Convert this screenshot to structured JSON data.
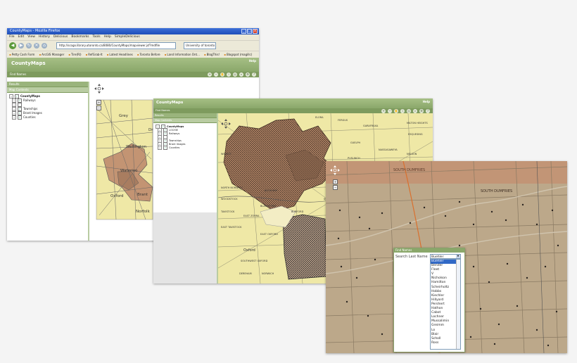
{
  "shot1": {
    "window_title": "CountyMaps - Mozilla Firefox",
    "window_buttons": [
      "_",
      "□",
      "x"
    ],
    "menu": [
      "File",
      "Edit",
      "View",
      "History",
      "Delicious",
      "Bookmarks",
      "Tools",
      "Help",
      "SimpleDelicious"
    ],
    "nav_icons": [
      "back-icon",
      "forward-icon",
      "reload-icon",
      "stop-icon",
      "home-icon"
    ],
    "nav_glyphs": {
      "back": "◀",
      "forward": "▶",
      "reload": "↻",
      "stop": "✕",
      "home": "⌂"
    },
    "url": "http://scogo.library.utoronto.ca/8080/CountyMaps/mapviewer.jsf?mdfile",
    "search_placeholder": "University of toronto",
    "bookmarks": [
      "Petty Cash Form",
      "ArcGIS Manager",
      "Tire(RI)",
      "RefGrab-It",
      "Latest Headlines",
      "Toronto Before",
      "Land Information Ont...",
      "BlogThis!",
      "Blogspot (magillc)"
    ],
    "app_title": "CountyMaps",
    "help": "Help",
    "find_names": "Find Names",
    "results": "Results",
    "map_contents": "Map Contents",
    "tree": {
      "root": "CountyMaps",
      "items": [
        "Railways",
        "",
        "Townships",
        "Brant Images",
        "Counties"
      ]
    },
    "map_labels": [
      "Grey",
      "Wellington",
      "Waterloo",
      "Oxford",
      "Brant",
      "Norfolk",
      "Dr"
    ],
    "tools": [
      "+",
      "−",
      "✋",
      "i",
      "◎",
      "⌕",
      "⚙",
      "?"
    ]
  },
  "shot2": {
    "app_title": "CountyMaps",
    "help": "Help",
    "find_names": "Find Names",
    "results": "Results",
    "map_contents": "Map Contents",
    "tree": {
      "root": "CountyMaps",
      "items": [
        "LOCHIE",
        "Railways",
        "",
        "Townships",
        "Brant Images",
        "Counties"
      ]
    },
    "map_labels": [
      "ELORA",
      "FERGUS",
      "GARAFRAXA",
      "MILTON HEIGHTS",
      "ESQUESING",
      "GUELPH",
      "PUSLINCH",
      "NASSAGAWEYA",
      "NELSON",
      "WILMOT",
      "BLENHEIM",
      "EAST ZORRA",
      "EAST OXFORD",
      "BLANDFORD",
      "BURFORD",
      "SOUTH DUMFRIES",
      "Oxford",
      "DEREHAM",
      "NORWICH",
      "OAKLAND",
      "WOODSTOCK",
      "NORTH NORWICH",
      "EAST TAVISTOCK",
      "TAVISTOCK",
      "SOUTHWEST OXFORD"
    ],
    "tools": [
      "+",
      "−",
      "✋",
      "i",
      "◎",
      "⌕",
      "⚙",
      "?"
    ]
  },
  "shot3": {
    "map_labels": [
      "SOUTH DUMFRIES",
      "SOUTH DUMFRIES"
    ],
    "finder": {
      "header": "Find Names",
      "label": "Search Last Name",
      "selected": "Buehler",
      "dropdown_arrow": "▼",
      "names": [
        "Buehler",
        "Bender",
        "Fleet",
        "V",
        "Nicholson",
        "Hamilton",
        "Scheirholtz",
        "Hobbs",
        "Kiechler",
        "Hillyard",
        "Pershert",
        "Hathon",
        "Cabot",
        "Lochner",
        "Mussalimin",
        "Greimm",
        "Lo",
        "Blair",
        "Scholl",
        "Ross"
      ]
    }
  },
  "colors": {
    "green_header": "#8aa76a",
    "map_yellow": "#efe8a6",
    "township_brown": "#c39473",
    "old_map_tan": "#bca88a",
    "select_blue": "#3169c6"
  }
}
